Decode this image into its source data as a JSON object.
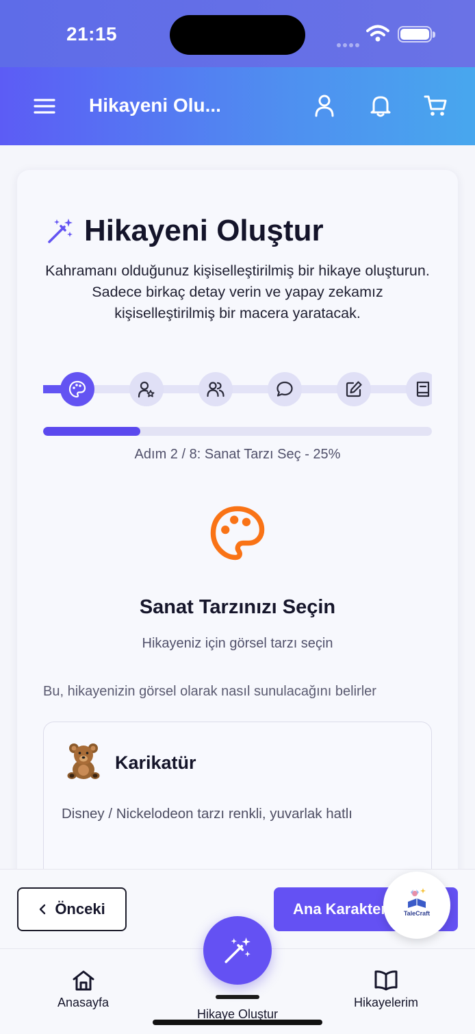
{
  "status_bar": {
    "time": "21:15"
  },
  "app_bar": {
    "title": "Hikayeni Olu...",
    "icons": [
      "menu-icon",
      "user-icon",
      "bell-icon",
      "cart-icon"
    ]
  },
  "page": {
    "title": "Hikayeni Oluştur",
    "intro": "Kahramanı olduğunuz kişiselleştirilmiş bir hikaye oluşturun. Sadece birkaç detay verin ve yapay zekamız kişiselleştirilmiş bir macera yaratacak."
  },
  "stepper": {
    "steps": [
      {
        "icon": "palette-icon",
        "active": true
      },
      {
        "icon": "user-star-icon",
        "active": false
      },
      {
        "icon": "users-icon",
        "active": false
      },
      {
        "icon": "message-circle-icon",
        "active": false
      },
      {
        "icon": "edit-icon",
        "active": false
      },
      {
        "icon": "book-icon",
        "active": false
      }
    ],
    "progress_fraction": 0.25,
    "label": "Adım 2 / 8: Sanat Tarzı Seç - 25%"
  },
  "section": {
    "title": "Sanat Tarzınızı Seçin",
    "subtitle": "Hikayeniz için görsel tarzı seçin",
    "hint": "Bu, hikayenizin görsel olarak nasıl sunulacağını belirler"
  },
  "options": [
    {
      "emoji": "teddy-bear",
      "title": "Karikatür",
      "description": "Disney / Nickelodeon tarzı renkli, yuvarlak hatlı"
    }
  ],
  "actions": {
    "prev_label": "Önceki",
    "next_label": "Ana Karakter"
  },
  "logo": {
    "text": "TaleCraft"
  },
  "tab_bar": {
    "home": "Anasayfa",
    "create": "Hikaye Oluştur",
    "stories": "Hikayelerim"
  },
  "colors": {
    "accent": "#6451f3",
    "palette_icon": "#f97316",
    "app_bar_start": "#5c5cf5",
    "app_bar_end": "#48a7ee"
  }
}
